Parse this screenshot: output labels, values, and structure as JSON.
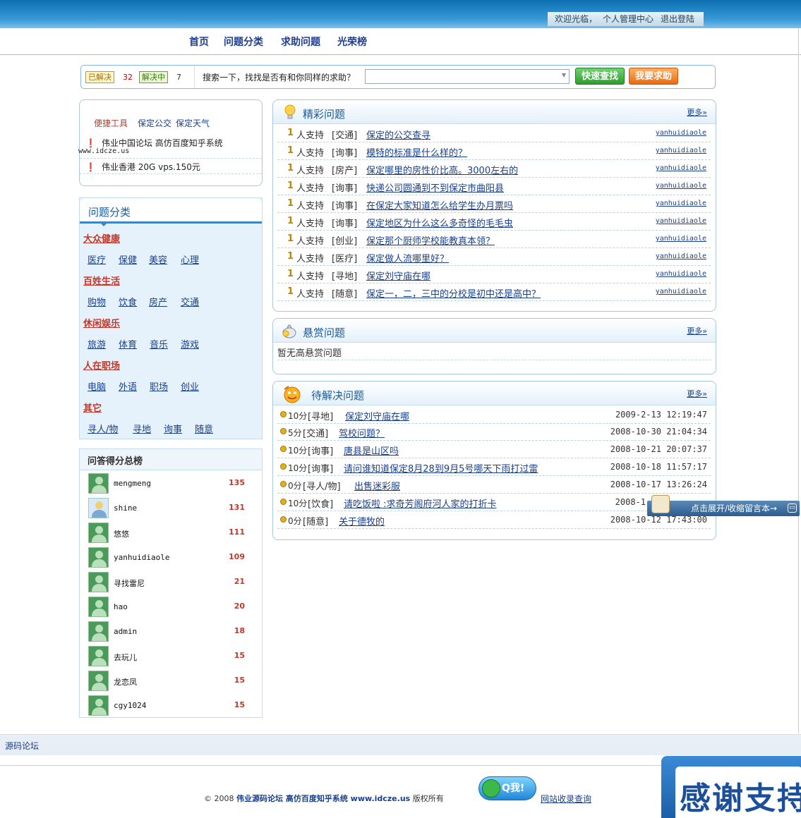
{
  "header": {
    "welcome": "欢迎光临，",
    "user_center": "个人管理中心",
    "logout": "退出登陆"
  },
  "nav": {
    "items": [
      "首页",
      "问题分类",
      "求助问题",
      "光荣榜"
    ]
  },
  "search": {
    "solved_label": "已解决",
    "solved_count": "32",
    "solving_label": "解决中",
    "solving_count": "7",
    "prompt": "搜索一下，找找是否有和你同样的求助？",
    "value": "",
    "quick_search": "快速查找",
    "ask_help": "我要求助"
  },
  "tools": {
    "title": "便捷工具",
    "link1": "保定公交",
    "link2": "保定天气",
    "line1": "伟业中国论坛 高仿百度知乎系统",
    "url": "www.idcze.us",
    "line2": "伟业香港 20G vps.150元"
  },
  "categories": {
    "title": "问题分类",
    "groups": [
      {
        "name": "大众健康",
        "subs": [
          "医疗",
          "保健",
          "美容",
          "心理"
        ]
      },
      {
        "name": "百姓生活",
        "subs": [
          "购物",
          "饮食",
          "房产",
          "交通"
        ]
      },
      {
        "name": "休闲娱乐",
        "subs": [
          "旅游",
          "体育",
          "音乐",
          "游戏"
        ]
      },
      {
        "name": "人在职场",
        "subs": [
          "电脑",
          "外语",
          "职场",
          "创业"
        ]
      },
      {
        "name": "其它",
        "subs": [
          "寻人/物",
          "寻地",
          "询事",
          "随意"
        ]
      }
    ]
  },
  "ranking": {
    "title": "问答得分总榜",
    "rows": [
      {
        "name": "mengmeng",
        "score": "135"
      },
      {
        "name": "shine",
        "score": "131"
      },
      {
        "name": "悠悠",
        "score": "111"
      },
      {
        "name": "yanhuidiaole",
        "score": "109"
      },
      {
        "name": "寻找雷尼",
        "score": "21"
      },
      {
        "name": "hao",
        "score": "20"
      },
      {
        "name": "admin",
        "score": "18"
      },
      {
        "name": "去玩儿",
        "score": "15"
      },
      {
        "name": "龙恋凤",
        "score": "15"
      },
      {
        "name": "cgy1024",
        "score": "15"
      }
    ]
  },
  "featured": {
    "title": "精彩问题",
    "more": "更多»",
    "rows": [
      {
        "num": "1",
        "support": "人支持",
        "cat": "[交通]",
        "title": "保定的公交查寻",
        "user": "yanhuidiaole"
      },
      {
        "num": "1",
        "support": "人支持",
        "cat": "[询事]",
        "title": "模特的标准是什么样的？",
        "user": "yanhuidiaole"
      },
      {
        "num": "1",
        "support": "人支持",
        "cat": "[房产]",
        "title": "保定哪里的房性价比高。3000左右的",
        "user": "yanhuidiaole"
      },
      {
        "num": "1",
        "support": "人支持",
        "cat": "[询事]",
        "title": "快递公司圆通到不到保定市曲阳县",
        "user": "yanhuidiaole"
      },
      {
        "num": "1",
        "support": "人支持",
        "cat": "[询事]",
        "title": "在保定大家知道怎么给学生办月票吗",
        "user": "yanhuidiaole"
      },
      {
        "num": "1",
        "support": "人支持",
        "cat": "[询事]",
        "title": "保定地区为什么这么多奇怪的毛毛虫",
        "user": "yanhuidiaole"
      },
      {
        "num": "1",
        "support": "人支持",
        "cat": "[创业]",
        "title": "保定那个厨师学校能教真本领？",
        "user": "yanhuidiaole"
      },
      {
        "num": "1",
        "support": "人支持",
        "cat": "[医疗]",
        "title": "保定做人流哪里好？",
        "user": "yanhuidiaole"
      },
      {
        "num": "1",
        "support": "人支持",
        "cat": "[寻地]",
        "title": "保定刘守庙在哪",
        "user": "yanhuidiaole"
      },
      {
        "num": "1",
        "support": "人支持",
        "cat": "[随意]",
        "title": "保定一，二，三中的分校是初中还是高中？",
        "user": "yanhuidiaole"
      }
    ]
  },
  "reward": {
    "title": "悬赏问题",
    "more": "更多»",
    "empty": "暂无高悬赏问题"
  },
  "pending": {
    "title": "待解决问题",
    "more": "更多»",
    "rows": [
      {
        "points": "10分",
        "cat": "[寻地]",
        "title": "保定刘守庙在哪",
        "time": "2009-2-13 12:19:47"
      },
      {
        "points": "5分",
        "cat": "[交通]",
        "title": "驾校问题？",
        "time": "2008-10-30 21:04:34"
      },
      {
        "points": "10分",
        "cat": "[询事]",
        "title": "唐县是山区吗",
        "time": "2008-10-21 20:07:37"
      },
      {
        "points": "10分",
        "cat": "[询事]",
        "title": "请问谁知道保定8月28到9月5号哪天下雨打过雷",
        "time": "2008-10-18 11:57:17"
      },
      {
        "points": "0分",
        "cat": "[寻人/物]",
        "title": "出售迷彩服",
        "time": "2008-10-17 13:26:24"
      },
      {
        "points": "10分",
        "cat": "[饮食]",
        "title": "请吃饭啦 :求奇芳阁府河人家的打折卡",
        "time": "2008-1"
      },
      {
        "points": "0分",
        "cat": "[随意]",
        "title": "关于德牧的",
        "time": "2008-10-12 17:43:00"
      }
    ]
  },
  "message_toggle": {
    "label": "点击展开/收缩留言本→"
  },
  "links": {
    "source": "源码论坛"
  },
  "footer": {
    "copyright_prefix": "© 2008",
    "site": "伟业源码论坛 高仿百度知乎系统 www.idcze.us",
    "rights": "版权所有",
    "qq": "Q我!",
    "record": "网站收录查询",
    "thanks": "感谢支持"
  }
}
